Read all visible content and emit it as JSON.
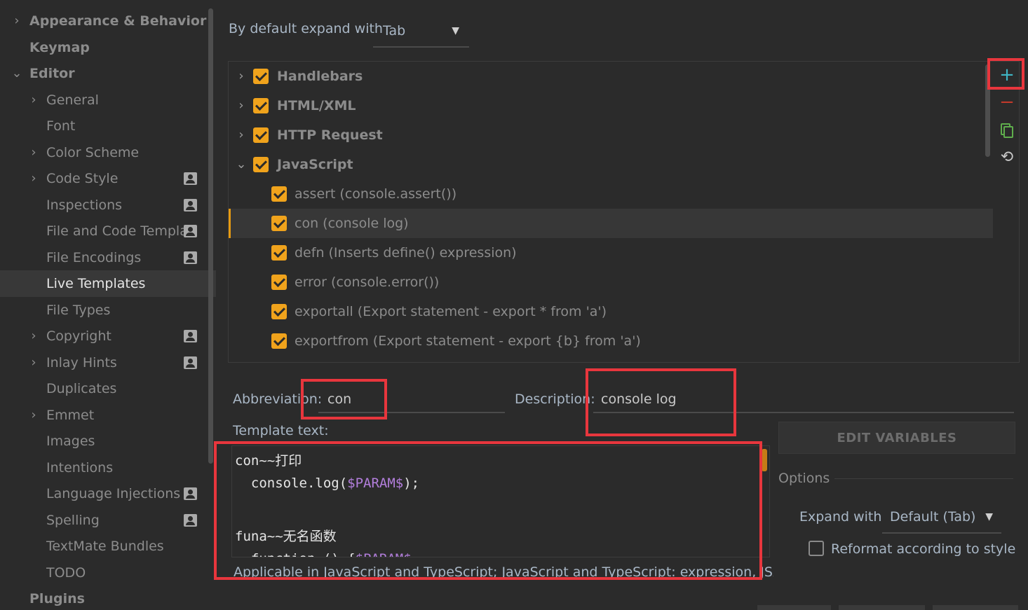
{
  "sidebar": {
    "items": [
      {
        "label": "Appearance & Behavior"
      },
      {
        "label": "Keymap"
      },
      {
        "label": "Editor"
      },
      {
        "label": "General"
      },
      {
        "label": "Font"
      },
      {
        "label": "Color Scheme"
      },
      {
        "label": "Code Style"
      },
      {
        "label": "Inspections"
      },
      {
        "label": "File and Code Templa"
      },
      {
        "label": "File Encodings"
      },
      {
        "label": "Live Templates"
      },
      {
        "label": "File Types"
      },
      {
        "label": "Copyright"
      },
      {
        "label": "Inlay Hints"
      },
      {
        "label": "Duplicates"
      },
      {
        "label": "Emmet"
      },
      {
        "label": "Images"
      },
      {
        "label": "Intentions"
      },
      {
        "label": "Language Injections"
      },
      {
        "label": "Spelling"
      },
      {
        "label": "TextMate Bundles"
      },
      {
        "label": "TODO"
      },
      {
        "label": "Plugins"
      }
    ],
    "badge_icon": "person-badge-icon"
  },
  "header": {
    "expand_label": "By default expand with",
    "expand_value": "Tab"
  },
  "tree": {
    "rows": [
      {
        "label": "Handlebars",
        "checked": true
      },
      {
        "label": "HTML/XML",
        "checked": true
      },
      {
        "label": "HTTP Request",
        "checked": true
      },
      {
        "label": "JavaScript",
        "checked": true
      },
      {
        "label": "assert (console.assert())",
        "checked": true
      },
      {
        "label": "con (console log)",
        "checked": true
      },
      {
        "label": "defn (Inserts define() expression)",
        "checked": true
      },
      {
        "label": "error (console.error())",
        "checked": true
      },
      {
        "label": "exportall (Export statement - export * from 'a')",
        "checked": true
      },
      {
        "label": "exportfrom (Export statement - export {b} from 'a')",
        "checked": true
      }
    ]
  },
  "toolbar": {
    "add": "+",
    "remove": "−",
    "restore": "⟲"
  },
  "form": {
    "abbreviation_label": "Abbreviation:",
    "abbreviation_value": "con",
    "description_label": "Description:",
    "description_value": "console log",
    "template_text_label": "Template text:",
    "template_lines": {
      "l1": "con~~打印",
      "l2_pre": "  console.log(",
      "l2_param": "$PARAM$",
      "l2_post": ");",
      "l4": "funa~~无名函数",
      "l5_pre": "  function () {",
      "l5_param": "$PARAM$"
    },
    "applicable": "Applicable in JavaScript and TypeScript; JavaScript and TypeScript: expression, JSX HTML,"
  },
  "right_panel": {
    "edit_variables": "EDIT VARIABLES",
    "options_label": "Options",
    "expand_with_label": "Expand with",
    "expand_with_value": "Default (Tab)",
    "reformat_label": "Reformat according to style",
    "reformat_checked": false
  },
  "colors": {
    "accent_checkbox": "#f0a31c",
    "annotation_red": "#e8363d",
    "add_icon": "#3fb5c4",
    "remove_icon": "#c0392b",
    "param_purple": "#b27edb"
  }
}
